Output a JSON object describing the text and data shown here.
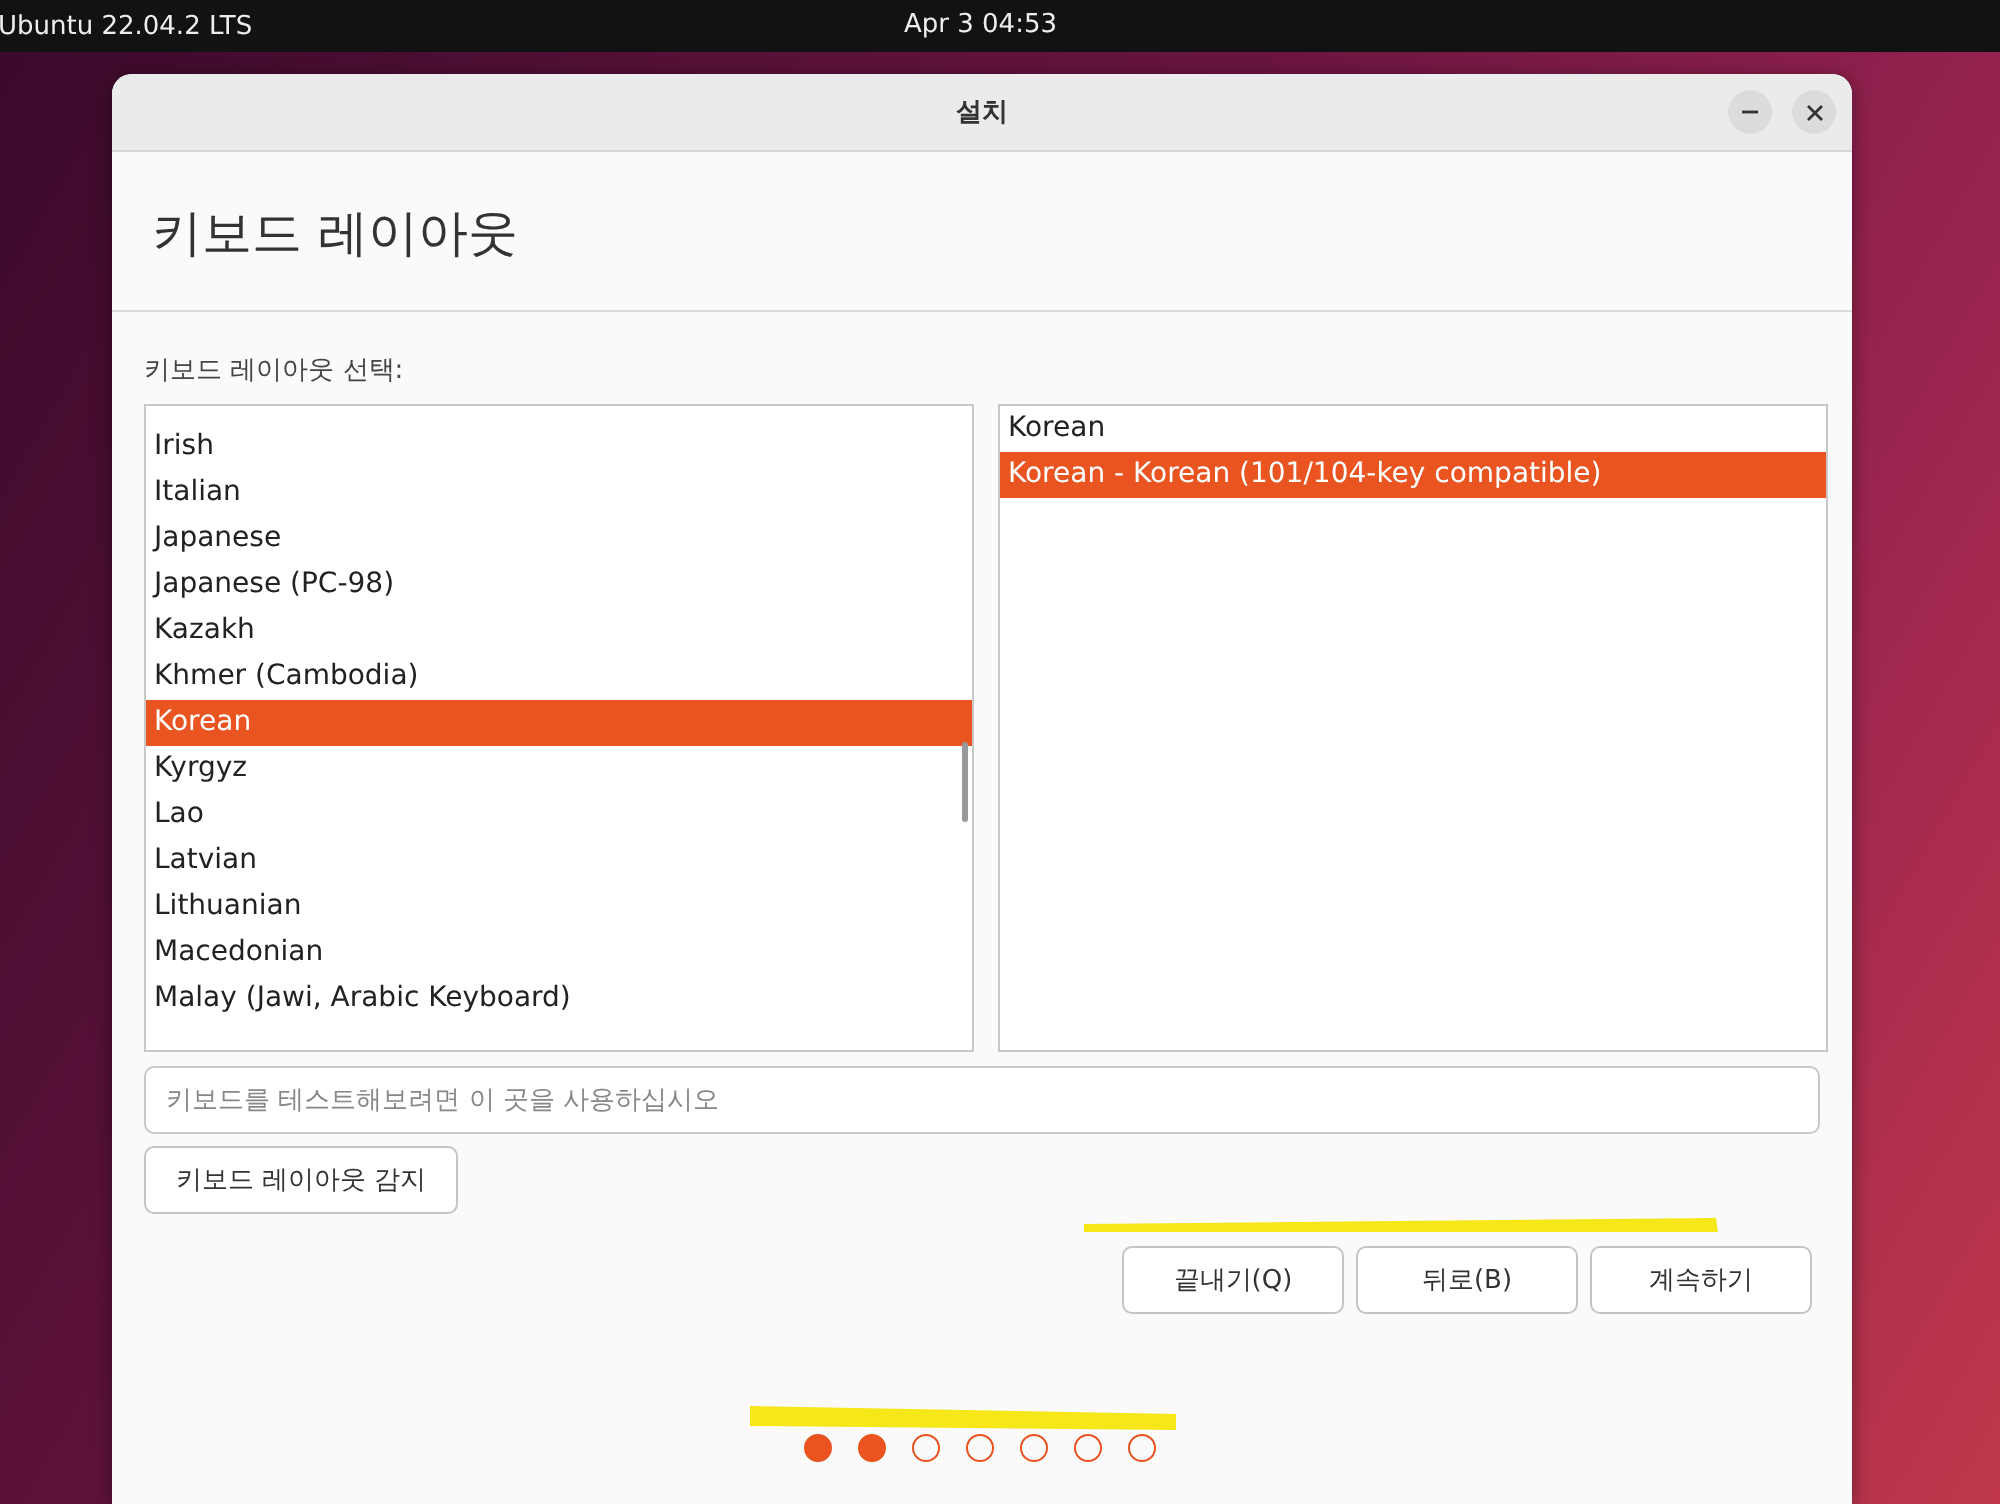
{
  "top_bar": {
    "system": "Ubuntu 22.04.2 LTS",
    "clock": "Apr 3  04:53"
  },
  "window": {
    "title": "설치",
    "heading": "키보드 레이아웃"
  },
  "layout_label": "키보드 레이아웃 선택:",
  "layouts": [
    {
      "label": "Irish",
      "selected": false
    },
    {
      "label": "Italian",
      "selected": false
    },
    {
      "label": "Japanese",
      "selected": false
    },
    {
      "label": "Japanese (PC-98)",
      "selected": false
    },
    {
      "label": "Kazakh",
      "selected": false
    },
    {
      "label": "Khmer (Cambodia)",
      "selected": false
    },
    {
      "label": "Korean",
      "selected": true
    },
    {
      "label": "Kyrgyz",
      "selected": false
    },
    {
      "label": "Lao",
      "selected": false
    },
    {
      "label": "Latvian",
      "selected": false
    },
    {
      "label": "Lithuanian",
      "selected": false
    },
    {
      "label": "Macedonian",
      "selected": false
    },
    {
      "label": "Malay (Jawi, Arabic Keyboard)",
      "selected": false
    }
  ],
  "variants": [
    {
      "label": "Korean",
      "selected": false
    },
    {
      "label": "Korean - Korean (101/104-key compatible)",
      "selected": true
    }
  ],
  "test_field": {
    "placeholder": "키보드를 테스트해보려면 이 곳을 사용하십시오"
  },
  "detect_button": "키보드 레이아웃 감지",
  "buttons": [
    "끝내기(Q)",
    "뒤로(B)",
    "계속하기"
  ],
  "progress": [
    {
      "done": true
    },
    {
      "done": true
    },
    {
      "done": false
    },
    {
      "done": false
    },
    {
      "done": false
    },
    {
      "done": false
    },
    {
      "done": false
    }
  ]
}
